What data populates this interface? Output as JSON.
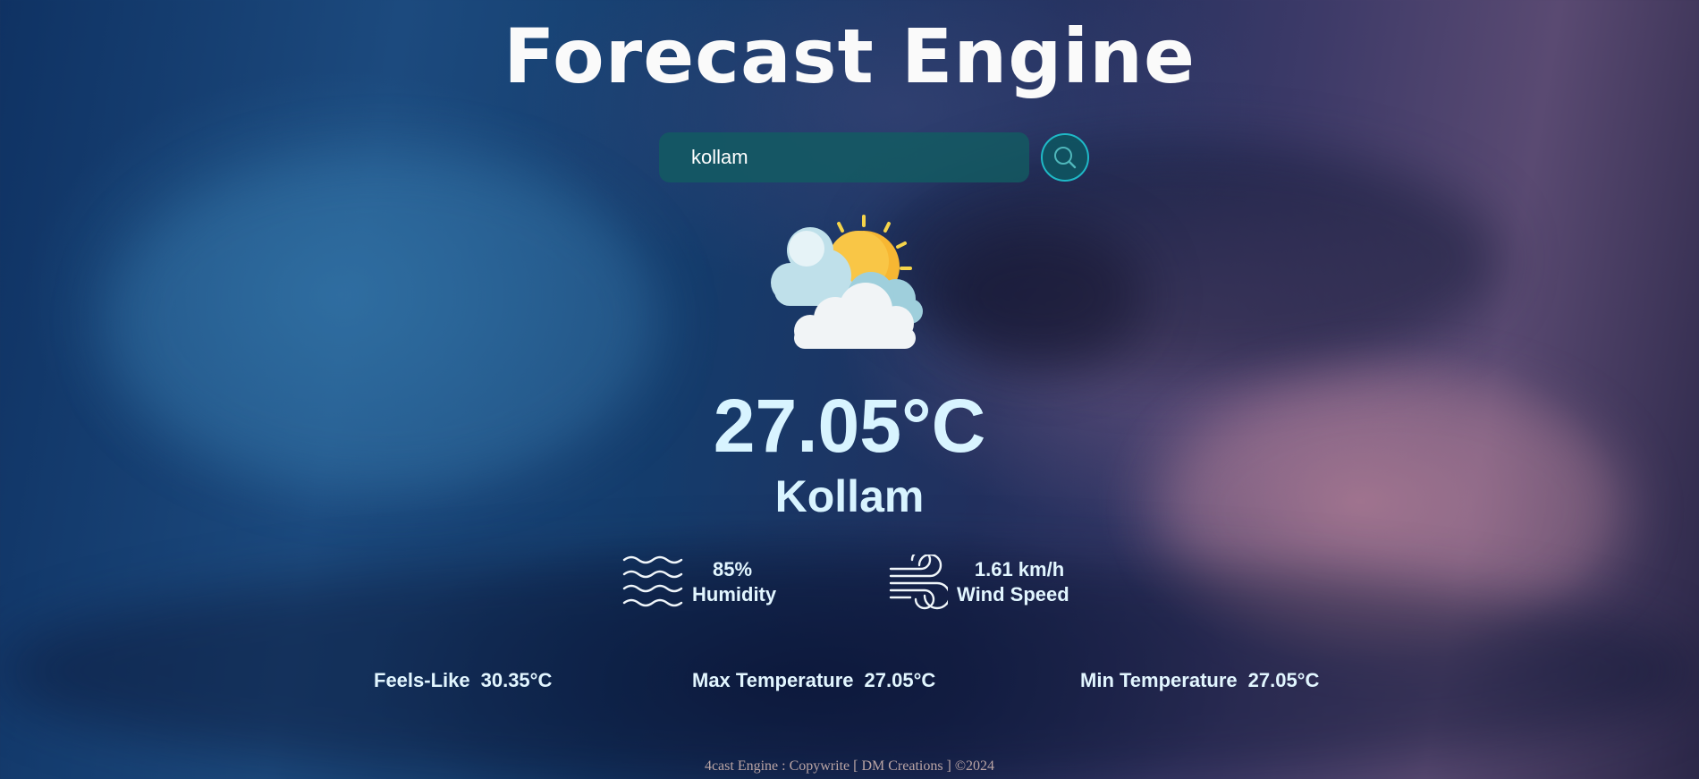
{
  "header": {
    "title": "Forecast Engine"
  },
  "search": {
    "value": "kollam",
    "button_icon": "search-icon"
  },
  "weather": {
    "icon": "partly-cloudy-icon",
    "temperature": "27.05°C",
    "city": "Kollam"
  },
  "details": {
    "humidity": {
      "icon": "waves-icon",
      "value": "85%",
      "label": "Humidity"
    },
    "wind": {
      "icon": "wind-icon",
      "value": "1.61 km/h",
      "label": "Wind Speed"
    }
  },
  "extras": {
    "feels_like": {
      "label": "Feels-Like",
      "value": "30.35°C"
    },
    "max_temp": {
      "label": "Max Temperature",
      "value": "27.05°C"
    },
    "min_temp": {
      "label": "Min Temperature",
      "value": "27.05°C"
    }
  },
  "footer": {
    "text": "4cast Engine : Copywrite [ DM Creations ] ©2024"
  },
  "colors": {
    "text_accent": "#d8f4ff",
    "search_bg": "#125c62",
    "search_button_ring": "#1fb9c7",
    "sun": "#f7b733"
  }
}
